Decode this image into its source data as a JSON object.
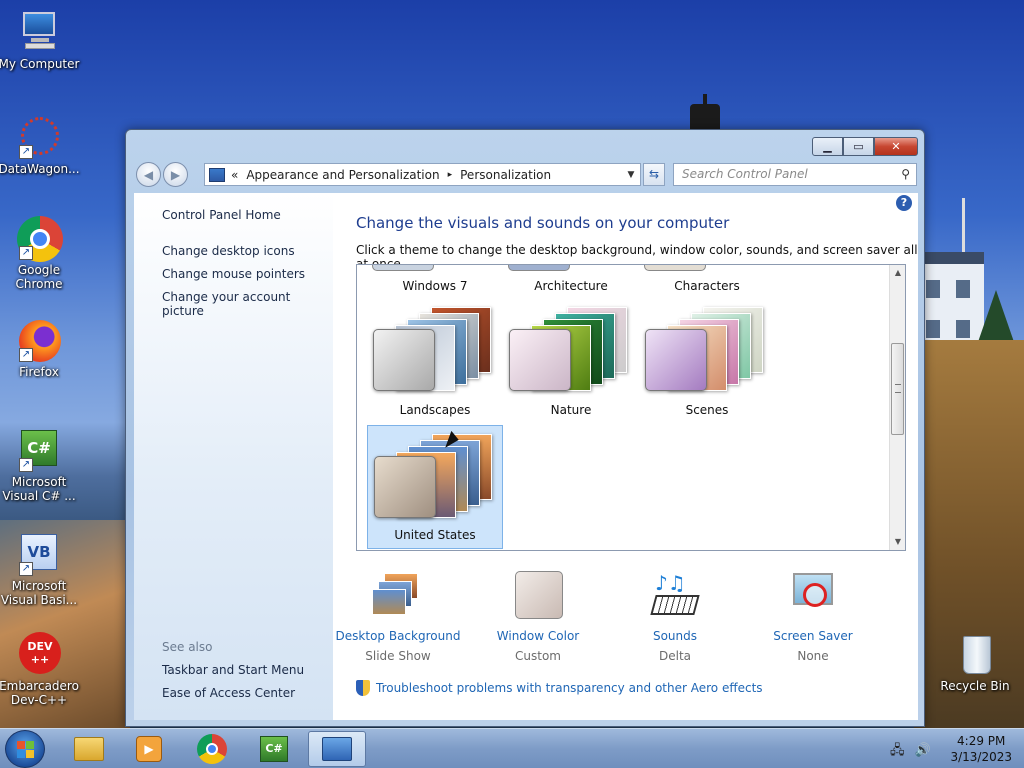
{
  "desktop": {
    "icons": [
      {
        "label": "My Computer",
        "icon": "computer-icon"
      },
      {
        "label": "DataWagon...",
        "icon": "datawagon-icon"
      },
      {
        "label": "Google Chrome",
        "icon": "chrome-icon"
      },
      {
        "label": "Firefox",
        "icon": "firefox-icon"
      },
      {
        "label": "Microsoft Visual C# ...",
        "icon": "visual-csharp-icon"
      },
      {
        "label": "Microsoft Visual Basi...",
        "icon": "visual-basic-icon"
      },
      {
        "label": "Embarcadero Dev-C++",
        "icon": "devcpp-icon"
      },
      {
        "label": "Recycle Bin",
        "icon": "recycle-bin-icon"
      }
    ]
  },
  "window": {
    "address": {
      "prefix": "«",
      "crumb1": "Appearance and Personalization",
      "sep": "▸",
      "crumb2": "Personalization"
    },
    "search_placeholder": "Search Control Panel",
    "left_pane": {
      "home": "Control Panel Home",
      "links": [
        "Change desktop icons",
        "Change mouse pointers",
        "Change your account picture"
      ],
      "see_also": "See also",
      "see_also_links": [
        "Taskbar and Start Menu",
        "Ease of Access Center"
      ]
    },
    "main": {
      "title": "Change the visuals and sounds on your computer",
      "subtitle": "Click a theme to change the desktop background, window color, sounds, and screen saver all at once.",
      "partial_themes": [
        "Windows 7",
        "Architecture",
        "Characters"
      ],
      "themes": [
        "Landscapes",
        "Nature",
        "Scenes",
        "United States"
      ],
      "selected_theme": "United States",
      "bottom_items": [
        {
          "title": "Desktop Background",
          "value": "Slide Show"
        },
        {
          "title": "Window Color",
          "value": "Custom"
        },
        {
          "title": "Sounds",
          "value": "Delta"
        },
        {
          "title": "Screen Saver",
          "value": "None"
        }
      ],
      "troubleshoot": "Troubleshoot problems with transparency and other Aero effects"
    }
  },
  "taskbar": {
    "time": "4:29 PM",
    "date": "3/13/2023",
    "apps": [
      "file-explorer-icon",
      "media-player-icon",
      "chrome-icon",
      "visual-csharp-icon",
      "control-panel-icon"
    ]
  }
}
